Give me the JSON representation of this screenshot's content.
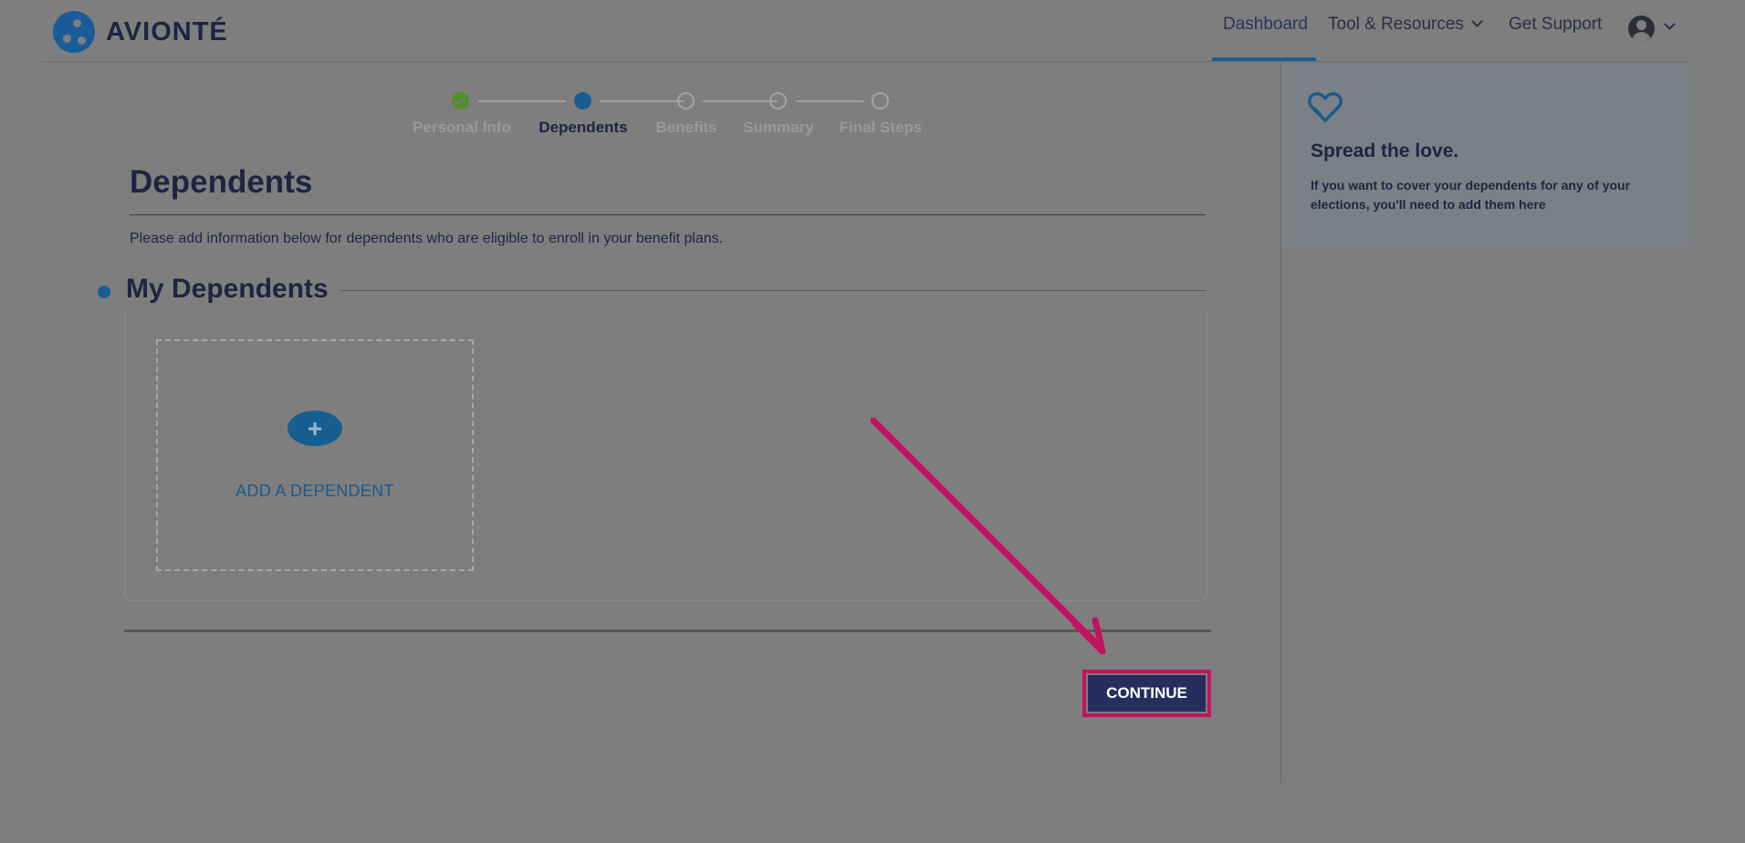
{
  "header": {
    "logo_text": "AVIONTÉ",
    "nav": {
      "dashboard": "Dashboard",
      "tools": "Tool & Resources",
      "support": "Get Support"
    }
  },
  "stepper": {
    "steps": [
      {
        "label": "Personal Info",
        "state": "complete"
      },
      {
        "label": "Dependents",
        "state": "current"
      },
      {
        "label": "Benefits",
        "state": "upcoming"
      },
      {
        "label": "Summary",
        "state": "upcoming"
      },
      {
        "label": "Final Steps",
        "state": "upcoming"
      }
    ]
  },
  "main": {
    "title": "Dependents",
    "intro": "Please add information below for dependents who are eligible to enroll in your benefit plans.",
    "section_title": "My Dependents",
    "add_symbol": "+",
    "add_label": "ADD A DEPENDENT",
    "continue_label": "CONTINUE"
  },
  "sidebar": {
    "title": "Spread the love.",
    "text": "If you want to cover your dependents for any of your elections, you'll need to add them here"
  },
  "colors": {
    "overlay_gray": "#7e7e7e",
    "brand_navy": "#252f5e",
    "accent_blue": "#175f93",
    "highlight_magenta": "#c0145f",
    "success_green": "#4f8f28"
  }
}
